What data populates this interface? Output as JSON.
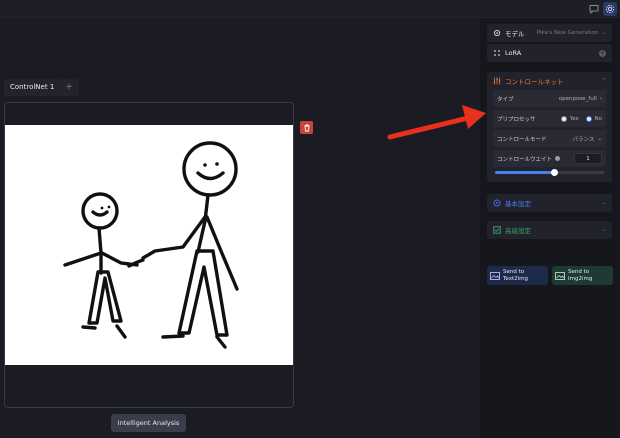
{
  "topbar": {
    "icons": [
      "chat-icon",
      "settings-gear-icon"
    ]
  },
  "workspace": {
    "tab_label": "ControlNet 1",
    "tab_add": "+",
    "analysis_button": "Intelligent Analysis"
  },
  "panel": {
    "model": {
      "label": "モデル",
      "value": "Pika's New Generation"
    },
    "lora": {
      "label": "LoRA"
    },
    "controlnet": {
      "title": "コントロールネット",
      "type_label": "タイプ",
      "type_value": "openpose_full",
      "preprocessor_label": "プリプロセッサ",
      "preprocessor_yes": "Yes",
      "preprocessor_no": "No",
      "preprocessor_selected": "No",
      "mode_label": "コントロールモード",
      "mode_value": "バランス",
      "weight_label": "コントロールウエイト",
      "weight_value": "1",
      "weight_slider_level": 0.55
    },
    "basic_settings": {
      "label": "基本設定"
    },
    "advanced_settings": {
      "label": "高級設定"
    },
    "send_text2img": {
      "line1": "Send to",
      "line2": "Text2img"
    },
    "send_img2img": {
      "line1": "Send to",
      "line2": "Img2img"
    }
  },
  "colors": {
    "accent_blue": "#3b6fe0",
    "controlnet_orange": "#e07a3a",
    "basic_blue": "#3b6fe0",
    "advanced_green": "#3aa06a",
    "delete_red": "#c8423e",
    "annotation_arrow": "#e8301c"
  }
}
